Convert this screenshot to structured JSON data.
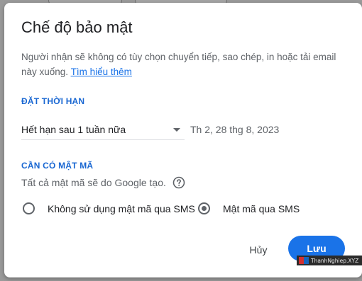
{
  "dialog": {
    "title": "Chế độ bảo mật",
    "description": "Người nhận sẽ không có tùy chọn chuyển tiếp, sao chép, in hoặc tải email này xuống.",
    "learn_more": "Tìm hiểu thêm"
  },
  "expiry": {
    "section_label": "ĐẶT THỜI HẠN",
    "selected_option": "Hết hạn sau 1 tuần nữa",
    "date": "Th 2, 28 thg 8, 2023"
  },
  "passcode": {
    "section_label": "CẦN CÓ MẬT MÃ",
    "hint": "Tất cả mật mã sẽ do Google tạo.",
    "options": [
      {
        "label": "Không sử dụng mật mã qua SMS",
        "checked": false
      },
      {
        "label": "Mật mã qua SMS",
        "checked": true
      }
    ]
  },
  "actions": {
    "cancel_label": "Hủy",
    "save_label": "Lưu"
  },
  "watermark": {
    "text": "ThanhNghiep.XYZ"
  },
  "colors": {
    "accent": "#1a73e8",
    "section_label": "#1967d2",
    "backdrop": "#9a9a9a"
  }
}
